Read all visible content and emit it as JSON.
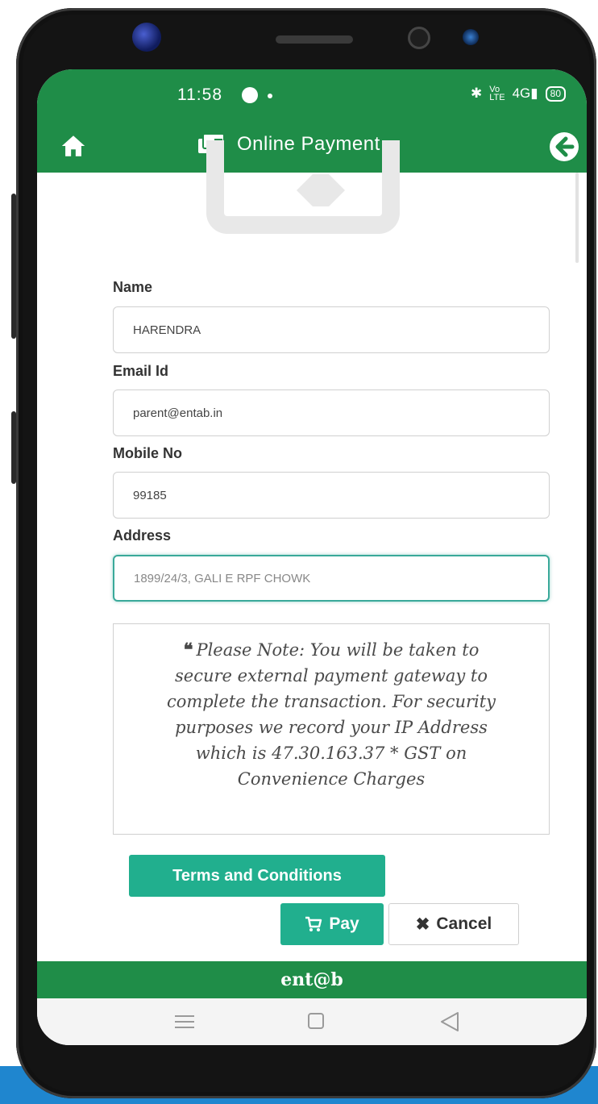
{
  "status_bar": {
    "time": "11:58",
    "right_icons": [
      "bluetooth-icon",
      "volte-icon",
      "4g-signal-icon"
    ],
    "battery": "80"
  },
  "app_bar": {
    "title": "Online Payment",
    "home_icon": "home-icon",
    "title_icon": "wallet-icon",
    "back_icon": "arrow-left-circle-icon"
  },
  "form": {
    "name_label": "Name",
    "name_value": "HARENDRA",
    "email_label": "Email Id",
    "email_value": "parent@entab.in",
    "mobile_label": "Mobile No",
    "mobile_value": "99185",
    "address_label": "Address",
    "address_value": "1899/24/3, GALI E RPF CHOWK"
  },
  "note": {
    "text": "Please Note: You will be taken to secure external payment gateway to complete the transaction. For security purposes we record your IP Address which is 47.30.163.37 * GST on Convenience Charges"
  },
  "buttons": {
    "terms": "Terms and Conditions",
    "pay": "Pay",
    "cancel": "Cancel"
  },
  "footer": {
    "logo_text": "ent@b"
  },
  "colors": {
    "primary_green": "#1f8d48",
    "button_teal": "#21af8e"
  }
}
